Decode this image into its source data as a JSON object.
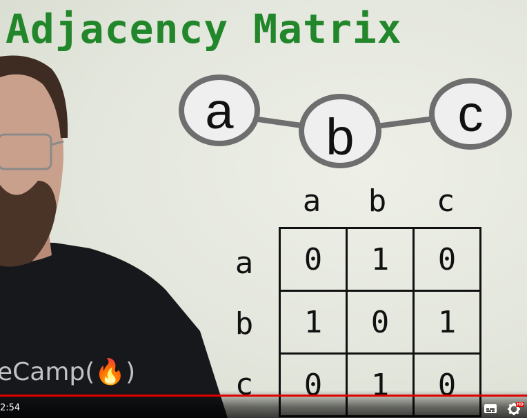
{
  "slide": {
    "title": "Adjacency Matrix",
    "graph": {
      "nodes": [
        "a",
        "b",
        "c"
      ],
      "edges": [
        [
          "a",
          "b"
        ],
        [
          "b",
          "c"
        ]
      ]
    },
    "matrix": {
      "column_headers": [
        "a",
        "b",
        "c"
      ],
      "row_headers": [
        "a",
        "b",
        "c"
      ],
      "rows": [
        [
          "0",
          "1",
          "0"
        ],
        [
          "1",
          "0",
          "1"
        ],
        [
          "0",
          "1",
          "0"
        ]
      ]
    },
    "shirt_text": "eCamp(🔥)"
  },
  "player": {
    "time_display": "2:54",
    "progress_fraction": 1.0,
    "progress_color": "#e00000",
    "hd_badge": "HD",
    "icons": [
      "subtitles-icon",
      "settings-icon"
    ]
  },
  "colors": {
    "title": "#22862a",
    "node_fill": "#efefef",
    "node_stroke": "#6e6e6e"
  }
}
